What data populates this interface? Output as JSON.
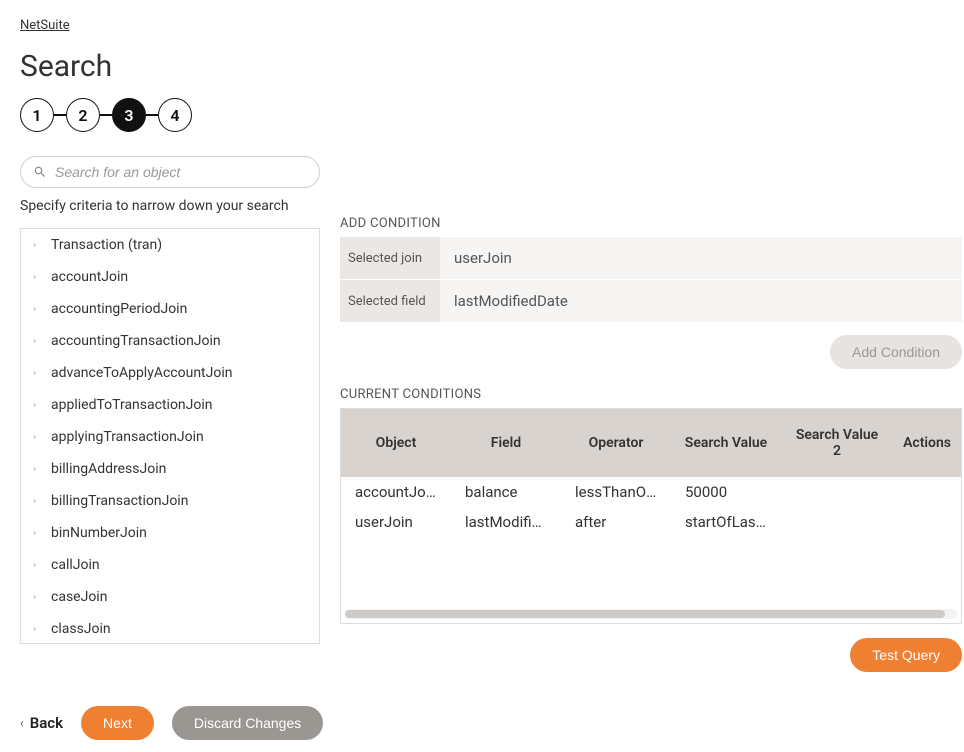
{
  "breadcrumb": {
    "label": "NetSuite"
  },
  "page_title": "Search",
  "stepper": {
    "steps": [
      "1",
      "2",
      "3",
      "4"
    ],
    "active_index": 2
  },
  "search": {
    "placeholder": "Search for an object"
  },
  "criteria_subtext": "Specify criteria to narrow down your search",
  "tree_items": [
    "Transaction (tran)",
    "accountJoin",
    "accountingPeriodJoin",
    "accountingTransactionJoin",
    "advanceToApplyAccountJoin",
    "appliedToTransactionJoin",
    "applyingTransactionJoin",
    "billingAddressJoin",
    "billingTransactionJoin",
    "binNumberJoin",
    "callJoin",
    "caseJoin",
    "classJoin"
  ],
  "add_condition": {
    "section_label": "ADD CONDITION",
    "rows": [
      {
        "label": "Selected join",
        "value": "userJoin"
      },
      {
        "label": "Selected field",
        "value": "lastModifiedDate"
      }
    ],
    "button_label": "Add Condition"
  },
  "current_conditions": {
    "section_label": "CURRENT CONDITIONS",
    "headers": [
      "Object",
      "Field",
      "Operator",
      "Search Value",
      "Search Value 2",
      "Actions"
    ],
    "rows": [
      {
        "object": "accountJoin",
        "field": "balance",
        "operator": "lessThanOr…",
        "value": "50000",
        "value2": ""
      },
      {
        "object": "userJoin",
        "field": "lastModifie…",
        "operator": "after",
        "value": "startOfLast…",
        "value2": ""
      }
    ]
  },
  "buttons": {
    "test_query": "Test Query",
    "back": "Back",
    "next": "Next",
    "discard": "Discard Changes"
  }
}
